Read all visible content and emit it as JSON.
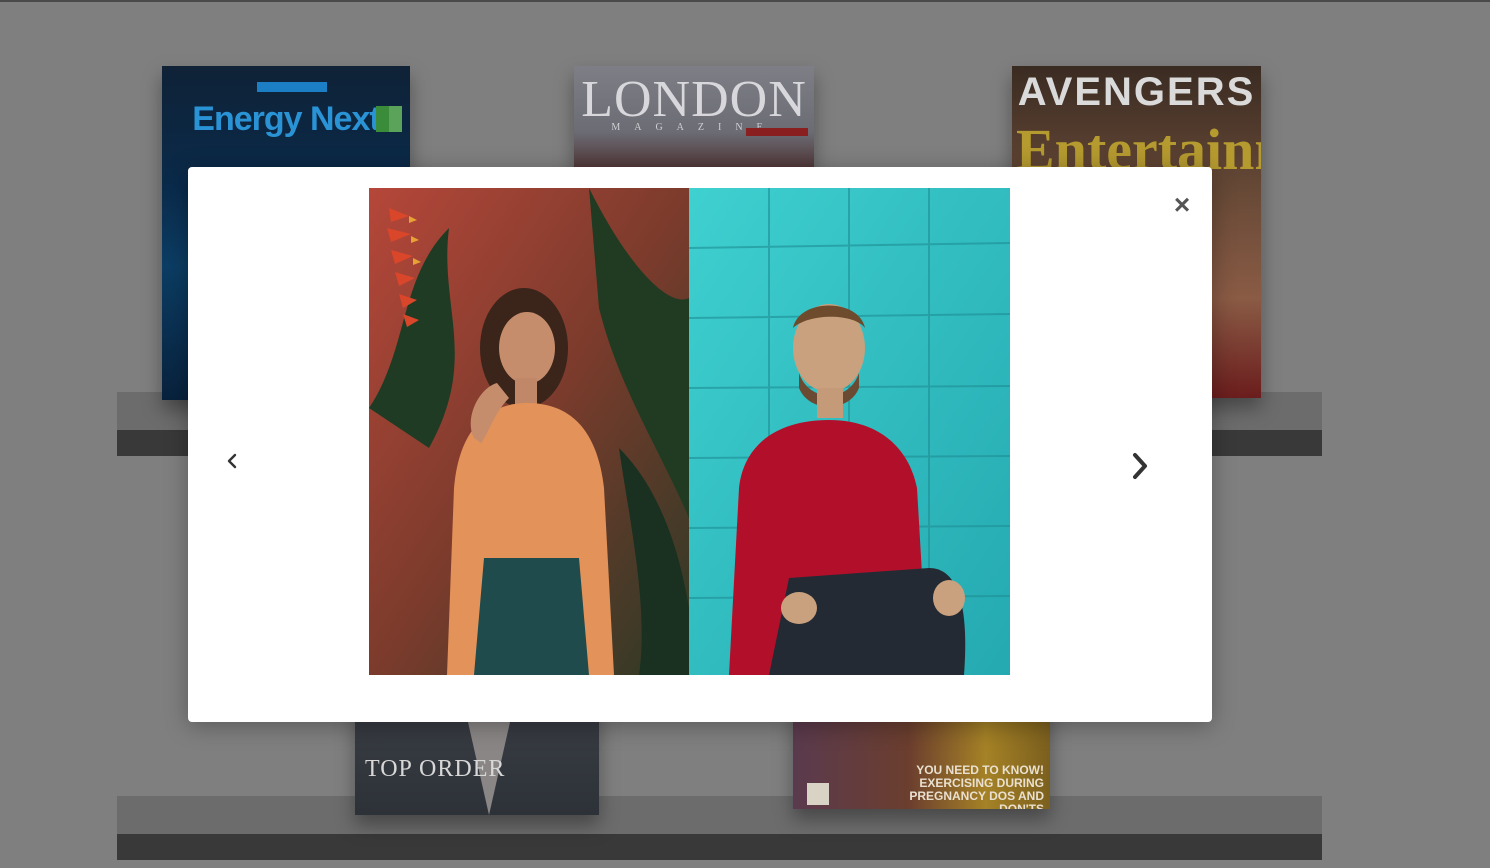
{
  "background": {
    "covers": [
      {
        "masthead": "Energy Next"
      },
      {
        "masthead": "LONDON",
        "subline": "MAGAZINE"
      },
      {
        "masthead": "AVENGERS",
        "subline": "Entertainment"
      },
      {
        "masthead": "TOP ORDER"
      },
      {
        "masthead": "YOU NEED TO KNOW! EXERCISING DURING PREGNANCY DOS AND DON'TS"
      }
    ]
  },
  "lightbox": {
    "close_label": "×",
    "image_alt": "Woman in orange shirt beside smiling man in red sweater"
  },
  "colors": {
    "page_backdrop": "#7f7f7f",
    "modal_bg": "#ffffff",
    "orange_shirt": "#e3925a",
    "red_sweater": "#b2102a",
    "teal_wall": "#33bfc4"
  },
  "icons": {
    "prev": "chevron-left-icon",
    "next": "chevron-right-icon",
    "close": "close-icon"
  }
}
